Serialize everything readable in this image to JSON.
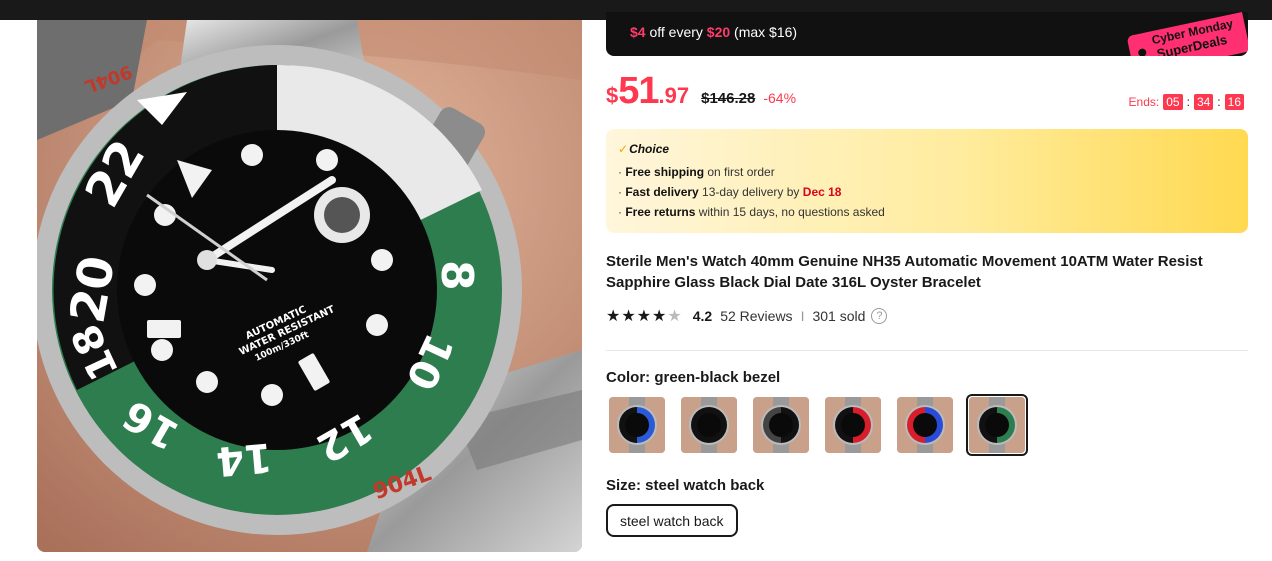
{
  "promo": {
    "seg1": "$4",
    "seg2": " off every ",
    "seg3": "$20",
    "seg4": " (max $16)",
    "tag_line1": "Cyber Monday",
    "tag_line2": "SuperDeals"
  },
  "price": {
    "currency": "$",
    "integer": "51",
    "decimal": ".97",
    "original": "$146.28",
    "discount": "-64%"
  },
  "countdown": {
    "label": "Ends:",
    "hours": "05",
    "minutes": "34",
    "seconds": "16"
  },
  "choice": {
    "badge": "Choice",
    "shipping_bold": "Free shipping",
    "shipping_rest": " on first order",
    "delivery_bold": "Fast delivery",
    "delivery_rest": " 13-day delivery by ",
    "delivery_date": "Dec 18",
    "returns_bold": "Free returns",
    "returns_rest": "  within 15 days, no questions asked"
  },
  "product": {
    "title": "Sterile Men's Watch 40mm Genuine NH35 Automatic Movement 10ATM Water Resist Sapphire Glass Black Dial Date 316L Oyster Bracelet"
  },
  "rating": {
    "value": "4.2",
    "stars": 4.2,
    "reviews": "52 Reviews",
    "separator": "I",
    "sold": "301 sold"
  },
  "color": {
    "label": "Color: green-black bezel",
    "options": [
      "blue-black bezel",
      "black bezel",
      "black-grey bezel",
      "red-black bezel",
      "blue-red bezel",
      "green-black bezel"
    ],
    "option_colors": [
      [
        "#2a5ad8",
        "#111111"
      ],
      [
        "#111111",
        "#111111"
      ],
      [
        "#111111",
        "#444444"
      ],
      [
        "#d81e2a",
        "#111111"
      ],
      [
        "#2a4ad8",
        "#d81e2a"
      ],
      [
        "#2e7d4f",
        "#111111"
      ]
    ],
    "selected_index": 5
  },
  "size": {
    "label": "Size: steel watch back",
    "option": "steel watch back"
  },
  "watch_face": {
    "bezel_numbers": [
      "20",
      "22",
      "8",
      "10",
      "12",
      "14",
      "16",
      "18"
    ],
    "dial_text1": "AUTOMATIC",
    "dial_text2": "WATER RESISTANT",
    "dial_text3": "100m/330ft",
    "engraving": "904L"
  },
  "colors": {
    "accent": "#fd384f",
    "dark": "#191919",
    "bezel_green": "#2e7d4f"
  }
}
